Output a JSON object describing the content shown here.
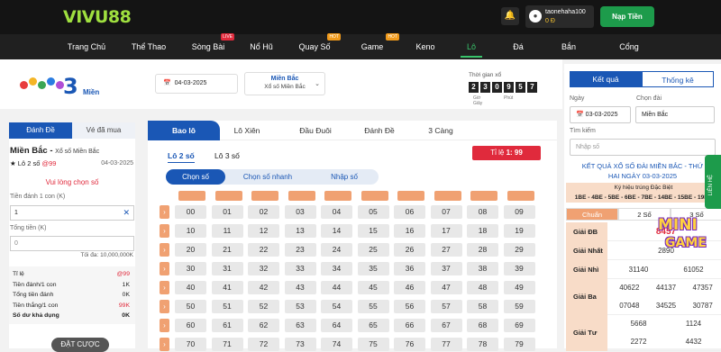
{
  "topbar": {
    "logo": "VIVU88",
    "username": "taonehaha100",
    "balance": "0 Đ",
    "deposit_label": "Nạp Tiền"
  },
  "nav": [
    {
      "label": "Trang Chủ",
      "badge": ""
    },
    {
      "label": "Thể Thao",
      "badge": ""
    },
    {
      "label": "Sòng Bài",
      "badge": "LIVE"
    },
    {
      "label": "Nổ Hũ",
      "badge": ""
    },
    {
      "label": "Quay Số",
      "badge": "HOT"
    },
    {
      "label": "Game Bài",
      "badge": "HOT"
    },
    {
      "label": "Keno",
      "badge": ""
    },
    {
      "label": "Lô Đề",
      "badge": "",
      "active": true
    },
    {
      "label": "Đá Gà",
      "badge": ""
    },
    {
      "label": "Bắn Cá",
      "badge": ""
    },
    {
      "label": "Cổng Game",
      "badge": ""
    }
  ],
  "header": {
    "brand_text": "Miền",
    "date": "04-03-2025",
    "region": "Miền Bắc",
    "region_sub": "Xổ số Miền Bắc",
    "timer_label": "Thời gian xổ",
    "timer_digits": [
      "2",
      "3",
      "0",
      "9",
      "5",
      "7"
    ],
    "timer_units": [
      "Giờ",
      "Phút",
      "Giây"
    ]
  },
  "left": {
    "tab_bet": "Đánh Đề",
    "tab_bought": "Vé đã mua",
    "title": "Miền Bắc",
    "title_sub": "Xổ số Miền Bắc",
    "game": "★ Lô 2 số",
    "game_rate": "@99",
    "date": "04-03-2025",
    "pick_msg": "Vui lòng chọn số",
    "label_per": "Tiền đánh 1 con (K)",
    "per_value": "1",
    "label_total": "Tổng tiền (K)",
    "total_value": "0",
    "max_bet": "Tối đa: 10,000,000K",
    "summary": [
      {
        "k": "Tỉ lệ",
        "v": "@99",
        "red": true
      },
      {
        "k": "Tiền đánh/1 con",
        "v": "1K"
      },
      {
        "k": "Tổng tiền đánh",
        "v": "0K"
      },
      {
        "k": "Tiền thắng/1 con",
        "v": "99K",
        "red": true
      },
      {
        "k": "Số dư khả dụng",
        "v": "0K",
        "bold": true
      }
    ],
    "place_bet": "ĐẶT CƯỢC"
  },
  "center": {
    "tabs": [
      "Bao lô",
      "Lô Xiên",
      "Đầu Đuôi",
      "Đánh Đề",
      "3 Càng"
    ],
    "subtabs": [
      "Lô 2 số",
      "Lô 3 số"
    ],
    "rate_label": "Tỉ lệ",
    "rate_value": "1: 99",
    "modes": [
      "Chọn số",
      "Chọn số nhanh",
      "Nhập số"
    ],
    "numbers": [
      [
        "00",
        "01",
        "02",
        "03",
        "04",
        "05",
        "06",
        "07",
        "08",
        "09"
      ],
      [
        "10",
        "11",
        "12",
        "13",
        "14",
        "15",
        "16",
        "17",
        "18",
        "19"
      ],
      [
        "20",
        "21",
        "22",
        "23",
        "24",
        "25",
        "26",
        "27",
        "28",
        "29"
      ],
      [
        "30",
        "31",
        "32",
        "33",
        "34",
        "35",
        "36",
        "37",
        "38",
        "39"
      ],
      [
        "40",
        "41",
        "42",
        "43",
        "44",
        "45",
        "46",
        "47",
        "48",
        "49"
      ],
      [
        "50",
        "51",
        "52",
        "53",
        "54",
        "55",
        "56",
        "57",
        "58",
        "59"
      ],
      [
        "60",
        "61",
        "62",
        "63",
        "64",
        "65",
        "66",
        "67",
        "68",
        "69"
      ],
      [
        "70",
        "71",
        "72",
        "73",
        "74",
        "75",
        "76",
        "77",
        "78",
        "79"
      ]
    ]
  },
  "right": {
    "tab_result": "Kết quả",
    "tab_stats": "Thống kê",
    "label_date": "Ngày",
    "date": "03-03-2025",
    "label_station": "Chọn đài",
    "station": "Miền Bắc",
    "label_search": "Tìm kiếm",
    "search_placeholder": "Nhập số",
    "result_title_1": "KẾT QUẢ XỔ SỐ ĐÀI MIỀN BẮC - THỨ",
    "result_title_2": "HAI NGÀY 03-03-2025",
    "special_label": "Ký hiệu trúng Đặc Biệt",
    "special_codes": "1BE - 4BE - 5BE - 6BE - 7BE - 14BE - 15BE - 19BE",
    "modes": [
      "Chuẩn",
      "2 Số",
      "3 Số"
    ],
    "rows": [
      {
        "name": "Giải ĐB",
        "values": [
          "8457"
        ]
      },
      {
        "name": "Giải Nhất",
        "values": [
          "2890"
        ]
      },
      {
        "name": "Giải Nhì",
        "values": [
          "31140",
          "61052"
        ]
      },
      {
        "name": "Giải Ba",
        "values": [
          "40622",
          "44137",
          "47357",
          "07048",
          "34525",
          "30787"
        ]
      },
      {
        "name": "Giải Tư",
        "values": [
          "5668",
          "1124",
          "2272",
          "4432"
        ]
      }
    ]
  },
  "overlay": {
    "mini_1": "MINI",
    "mini_2": "GAME",
    "contact": "LIÊN HỆ"
  }
}
